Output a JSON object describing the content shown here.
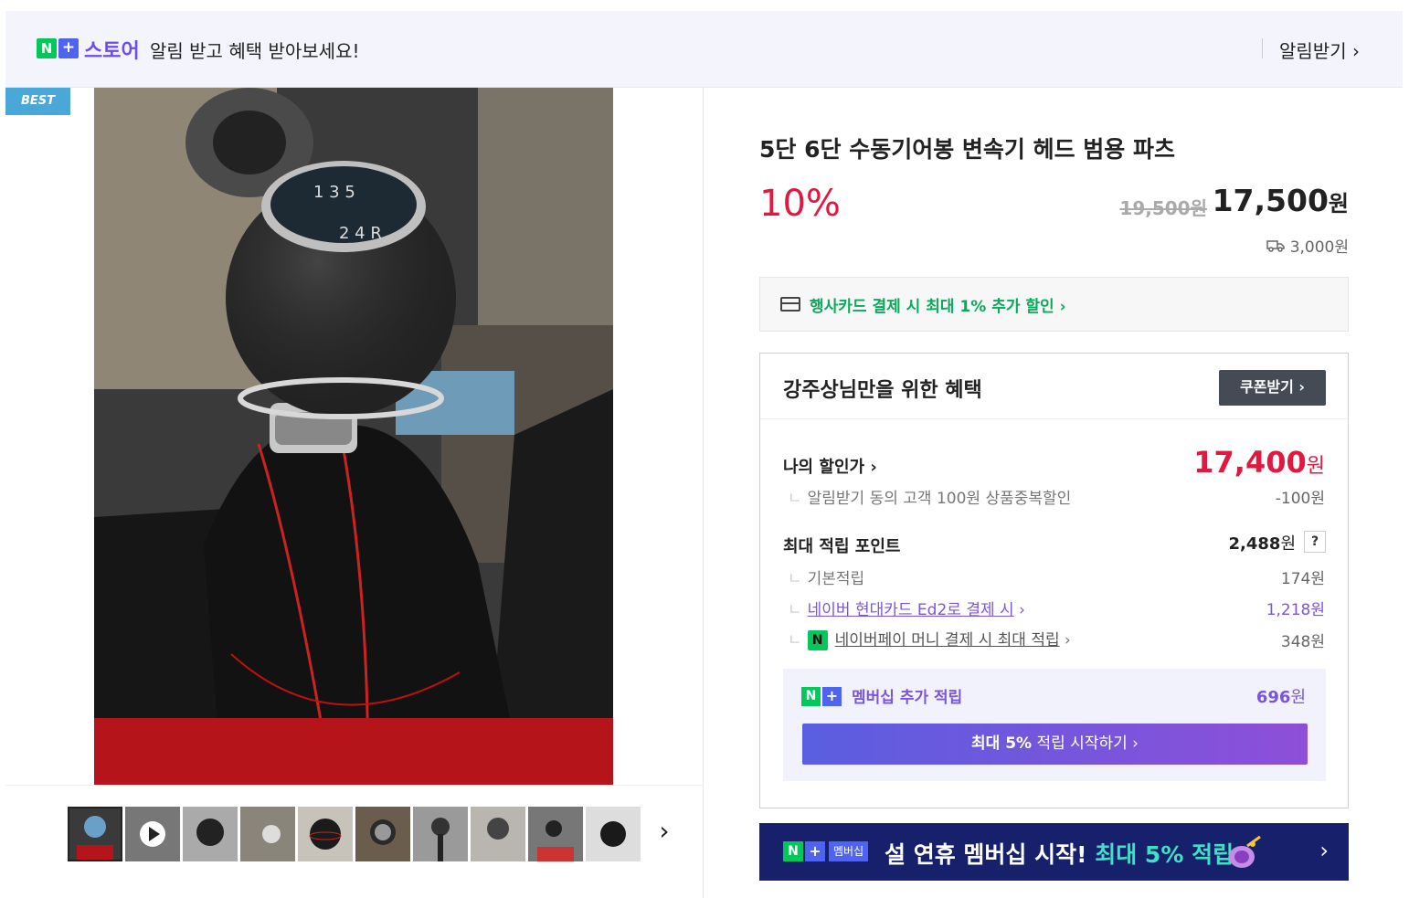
{
  "banner": {
    "logo_n": "N",
    "logo_plus": "+",
    "store_label": "스토어",
    "message": "알림 받고 혜택 받아보세요!",
    "subscribe_link": "알림받기 ›"
  },
  "gallery": {
    "badge": "BEST",
    "next_icon": "›"
  },
  "product": {
    "title": "5단 6단 수동기어봉 변속기 헤드 범용 파츠",
    "discount_rate": "10%",
    "original_price": "19,500원",
    "sale_price": "17,500",
    "sale_price_unit": "원",
    "shipping_fee": "3,000원"
  },
  "card_promo": {
    "text": "행사카드 결제 시 최대 1% 추가 할인 ›"
  },
  "benefits": {
    "title": "강주상님만을 위한 혜택",
    "coupon_button": "쿠폰받기 ›",
    "my_price_label": "나의 할인가 ›",
    "my_price": "17,400",
    "my_price_unit": "원",
    "alarm_discount_label": "알림받기 동의 고객 100원 상품중복할인",
    "alarm_discount_value": "-100원",
    "max_points_label": "최대 적립 포인트",
    "max_points_value": "2,488",
    "max_points_unit": "원",
    "help_icon": "?",
    "basic_points_label": "기본적립",
    "basic_points_value": "174원",
    "card_points_label": "네이버 현대카드 Ed2로 결제 시",
    "card_points_arrow": "›",
    "card_points_value": "1,218원",
    "npay_icon": "N",
    "npay_points_label": "네이버페이 머니 결제 시 최대 적립",
    "npay_points_arrow": "›",
    "npay_points_value": "348원",
    "tick": "ㄴ"
  },
  "membership": {
    "label": "멤버십 추가 적립",
    "value": "696",
    "value_unit": "원",
    "cta_bold": "최대 5%",
    "cta_rest": " 적립 시작하기 ›"
  },
  "promo_banner": {
    "logo_m": "멤버십",
    "text_main": "설 연휴 멤버십 시작! ",
    "text_accent": "최대 5% 적립",
    "arrow": "›"
  },
  "colors": {
    "discount_red": "#e1183f",
    "naver_green": "#03c75a",
    "membership_purple": "#7b55e0",
    "banner_navy": "#17206b"
  }
}
